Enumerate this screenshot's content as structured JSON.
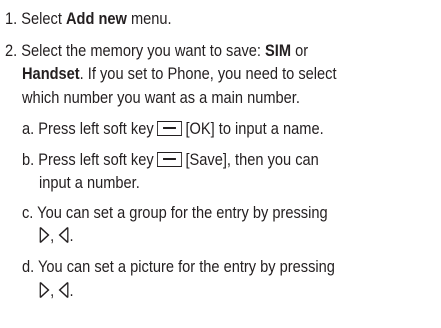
{
  "steps": [
    {
      "num": "1.",
      "before": "Select ",
      "bold": "Add new",
      "after": " menu."
    },
    {
      "num": "2.",
      "line1_before": "Select the memory you want to save: ",
      "line1_bold": "SIM",
      "line1_after": " or",
      "line2_bold": "Handset",
      "line2_after": ". If you set to Phone, you need to select",
      "line3": "which number you want as a main number."
    }
  ],
  "substeps": [
    {
      "letter": "a.",
      "before": "Press left soft key",
      "after": "[OK] to input a name."
    },
    {
      "letter": "b.",
      "before": "Press left soft key",
      "after": "[Save], then you can",
      "line2": "input a number."
    },
    {
      "letter": "c.",
      "line1": "You can set a group for the entry by pressing",
      "comma": ",",
      "end": "."
    },
    {
      "letter": "d.",
      "line1": "You can set  a picture for the entry by pressing",
      "comma": ",",
      "end": "."
    }
  ],
  "icons": {
    "softkey": "left-soft-key-icon",
    "right": "navigation-right-icon",
    "left": "navigation-left-icon"
  }
}
